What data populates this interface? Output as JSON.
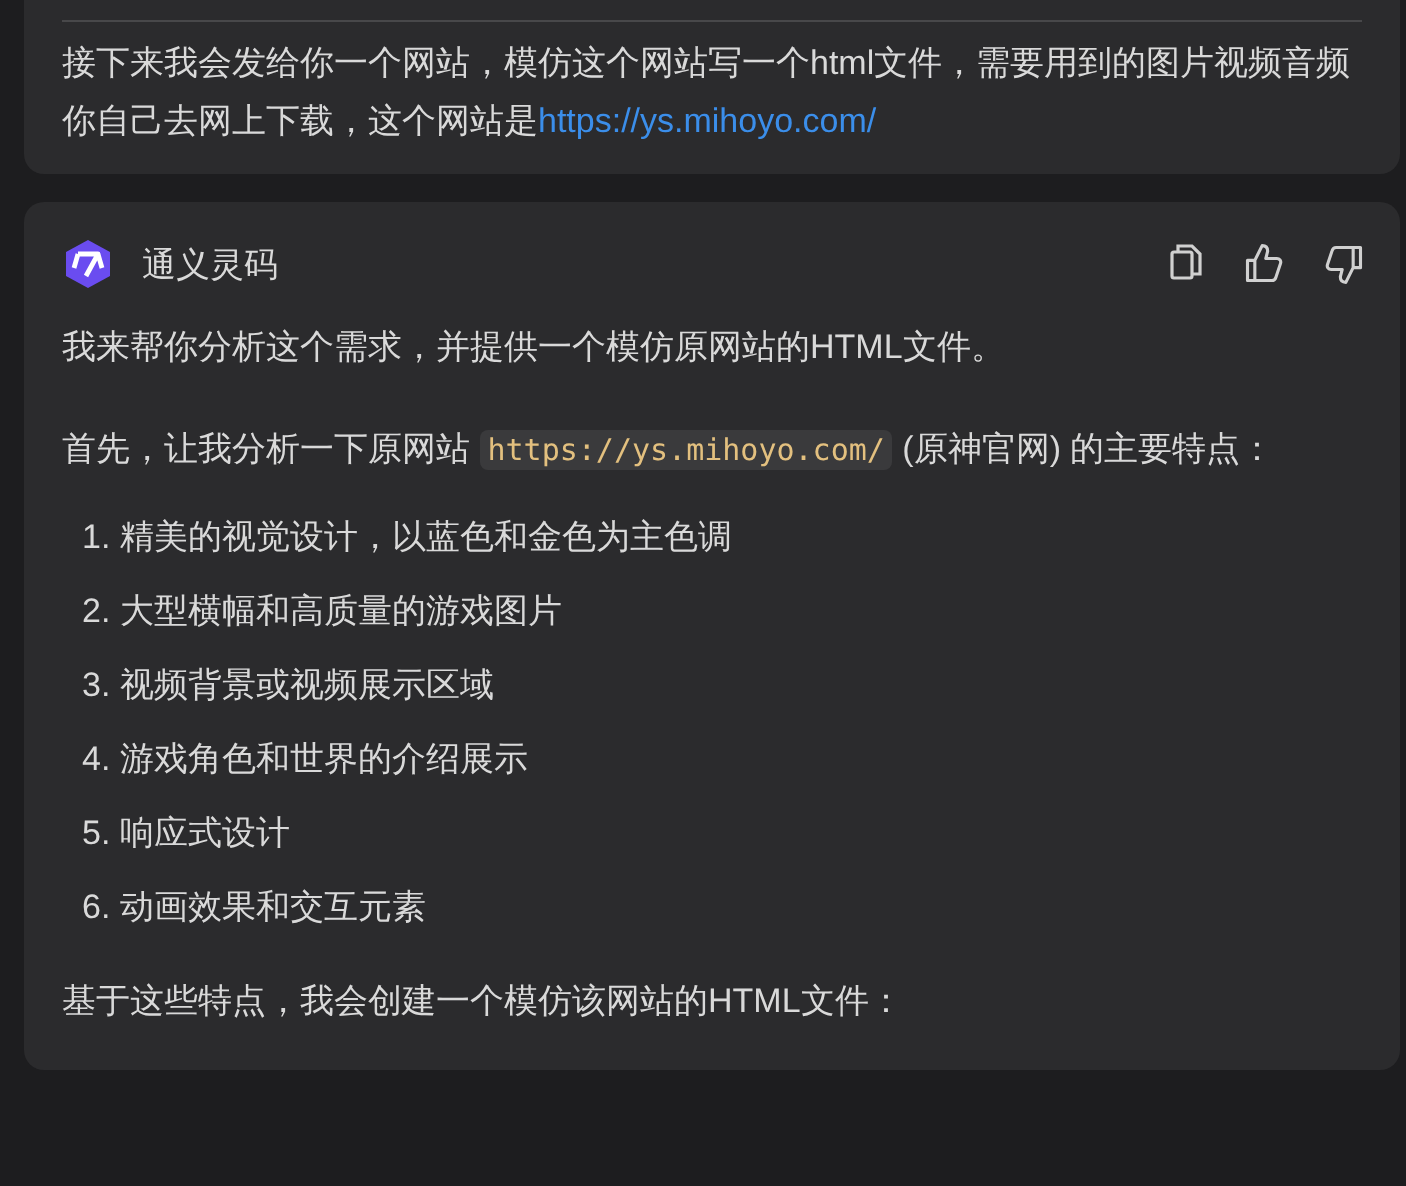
{
  "user_message": {
    "text": "接下来我会发给你一个网站，模仿这个网站写一个html文件，需要用到的图片视频音频你自己去网上下载，这个网站是",
    "link": "https://ys.mihoyo.com/"
  },
  "reply": {
    "assistant_name": "通义灵码",
    "intro": "我来帮你分析这个需求，并提供一个模仿原网站的HTML文件。",
    "analysis": {
      "before": "首先，让我分析一下原网站",
      "code": "https://ys.mihoyo.com/",
      "after": "(原神官网) 的主要特点："
    },
    "features": [
      {
        "number": "1.",
        "text": "精美的视觉设计，以蓝色和金色为主色调"
      },
      {
        "number": "2.",
        "text": "大型横幅和高质量的游戏图片"
      },
      {
        "number": "3.",
        "text": "视频背景或视频展示区域"
      },
      {
        "number": "4.",
        "text": "游戏角色和世界的介绍展示"
      },
      {
        "number": "5.",
        "text": "响应式设计"
      },
      {
        "number": "6.",
        "text": "动画效果和交互元素"
      }
    ],
    "conclusion": "基于这些特点，我会创建一个模仿该网站的HTML文件："
  }
}
